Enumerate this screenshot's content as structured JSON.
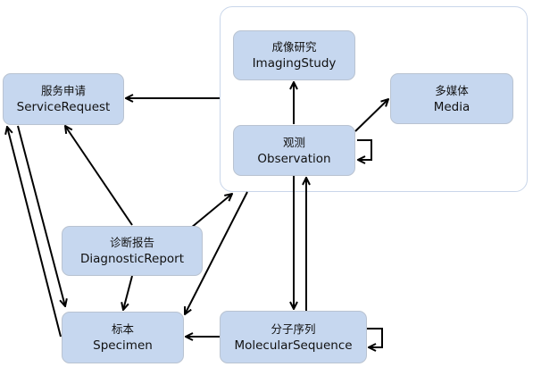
{
  "nodes": {
    "service_request": {
      "zh": "服务申请",
      "en": "ServiceRequest"
    },
    "imaging_study": {
      "zh": "成像研究",
      "en": "ImagingStudy"
    },
    "media": {
      "zh": "多媒体",
      "en": "Media"
    },
    "observation": {
      "zh": "观测",
      "en": "Observation"
    },
    "diagnostic_report": {
      "zh": "诊断报告",
      "en": "DiagnosticReport"
    },
    "specimen": {
      "zh": "标本",
      "en": "Specimen"
    },
    "molecular_sequence": {
      "zh": "分子序列",
      "en": "MolecularSequence"
    }
  },
  "colors": {
    "node_fill": "#c6d7ef",
    "node_border": "#b9c3d1",
    "edge": "#000000"
  }
}
